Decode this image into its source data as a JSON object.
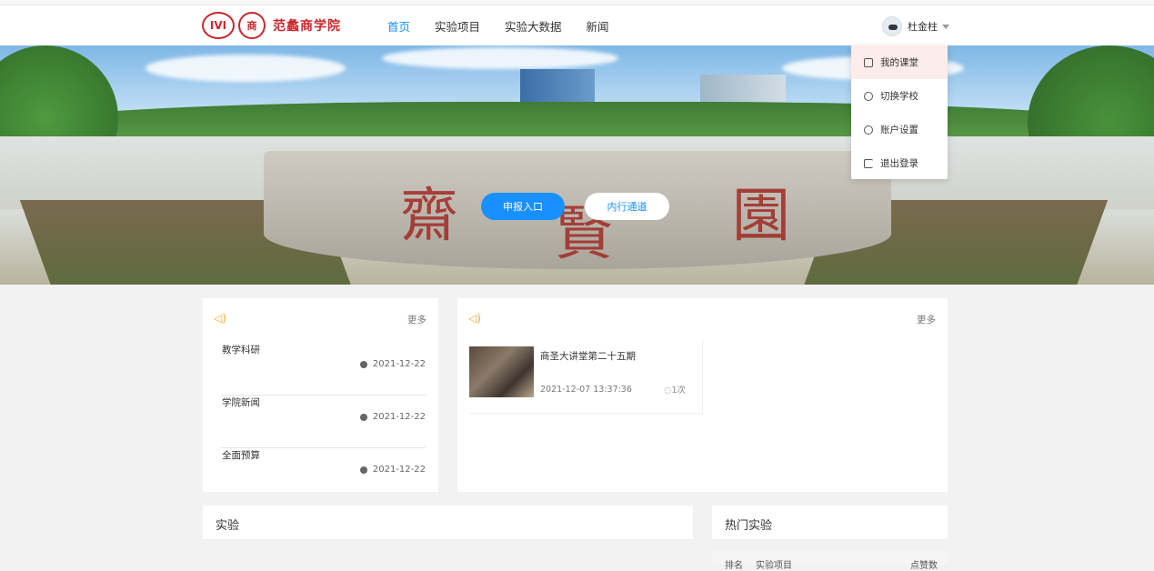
{
  "logo": {
    "text": "范蠡商学院",
    "seal1": "IVI",
    "seal2": "商"
  },
  "nav": {
    "items": [
      "首页",
      "实验项目",
      "实验大数据",
      "新闻"
    ]
  },
  "user": {
    "name": "杜金柱"
  },
  "banner": {
    "stone_chars": [
      "齋",
      "賢",
      "園"
    ]
  },
  "buttons": {
    "apply": "申报入口",
    "channel": "内行通道"
  },
  "dropdown": {
    "items": [
      "我的课堂",
      "切换学校",
      "账户设置",
      "退出登录"
    ]
  },
  "notices": {
    "more": "更多",
    "items": [
      {
        "title": "教学科研",
        "date": "2021-12-22"
      },
      {
        "title": "学院新闻",
        "date": "2021-12-22"
      },
      {
        "title": "全面预算",
        "date": "2021-12-22"
      }
    ]
  },
  "news": {
    "more": "更多",
    "item": {
      "title": "商圣大讲堂第二十五期",
      "time": "2021-12-07 13:37:36",
      "views": "1次"
    }
  },
  "sections": {
    "experiments": "实验",
    "hot": "热门实验"
  },
  "hot_table": {
    "col1": "排名",
    "col2": "实验项目",
    "col3": "点赞数"
  },
  "colors": {
    "accent": "#1890ff",
    "brand": "#c9282d",
    "speaker": "#f5a623"
  }
}
